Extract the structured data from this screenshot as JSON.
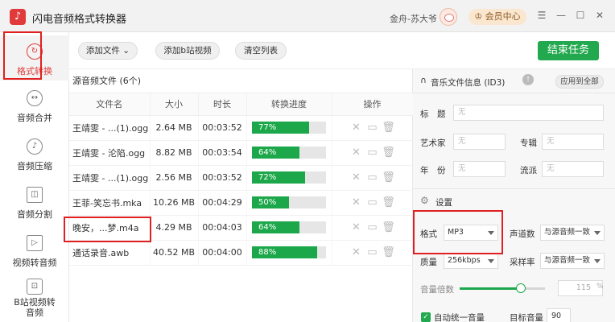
{
  "app": {
    "title": "闪电音频格式转换器",
    "user_name": "金舟-苏大爷",
    "vip_label": "会员中心",
    "window_buttons": [
      "☰",
      "—",
      "☐",
      "✕"
    ]
  },
  "sidebar": {
    "items": [
      {
        "label": "格式转换",
        "icon": "convert-icon",
        "active": true
      },
      {
        "label": "音频合并",
        "icon": "merge-icon",
        "active": false
      },
      {
        "label": "音频压缩",
        "icon": "compress-icon",
        "active": false
      },
      {
        "label": "音频分割",
        "icon": "split-icon",
        "active": false
      },
      {
        "label": "视频转音频",
        "icon": "video-to-audio-icon",
        "active": false
      },
      {
        "label": "B站视频转音频",
        "icon": "bilibili-icon",
        "active": false
      }
    ]
  },
  "toolbar": {
    "add_file": "添加文件",
    "add_bilibili": "添加b站视频",
    "clear_list": "清空列表",
    "finish": "结束任务"
  },
  "file_list": {
    "title": "源音频文件 (6个)",
    "columns": [
      "文件名",
      "大小",
      "时长",
      "转换进度",
      "操作"
    ],
    "rows": [
      {
        "name": "王靖雯 - ...(1).ogg",
        "size": "2.64 MB",
        "duration": "00:03:52",
        "progress": "77%"
      },
      {
        "name": "王靖雯 - 沦陷.ogg",
        "size": "8.82 MB",
        "duration": "00:03:54",
        "progress": "64%"
      },
      {
        "name": "王靖雯 - ...(1).ogg",
        "size": "2.56 MB",
        "duration": "00:03:52",
        "progress": "72%"
      },
      {
        "name": "王菲-笑忘书.mka",
        "size": "10.26 MB",
        "duration": "00:04:29",
        "progress": "50%"
      },
      {
        "name": "晚安，...梦.m4a",
        "size": "4.29 MB",
        "duration": "00:04:03",
        "progress": "64%"
      },
      {
        "name": "通话录音.awb",
        "size": "40.52 MB",
        "duration": "00:04:00",
        "progress": "88%"
      }
    ]
  },
  "id3": {
    "title": "音乐文件信息 (ID3)",
    "apply_all": "应用到全部",
    "labels": {
      "title": "标　题",
      "artist": "艺术家",
      "album": "专辑",
      "year": "年　份",
      "genre": "流派"
    },
    "placeholder": "无"
  },
  "settings": {
    "title": "设置",
    "format_label": "格式",
    "format_value": "MP3",
    "channel_label": "声道数",
    "channel_value": "与源音频一致",
    "quality_label": "质量",
    "quality_value": "256kbps",
    "samplerate_label": "采样率",
    "samplerate_value": "与源音频一致",
    "volume_label": "音量倍数",
    "volume_value": "115",
    "volume_unit": "%",
    "volume_level": 0.72,
    "auto_volume_label": "自动统一音量",
    "target_volume_label": "目标音量",
    "target_volume_value": "90"
  },
  "colors": {
    "accent_red": "#e03a3a",
    "accent_green": "#22a84e",
    "highlight": "#e02020"
  }
}
